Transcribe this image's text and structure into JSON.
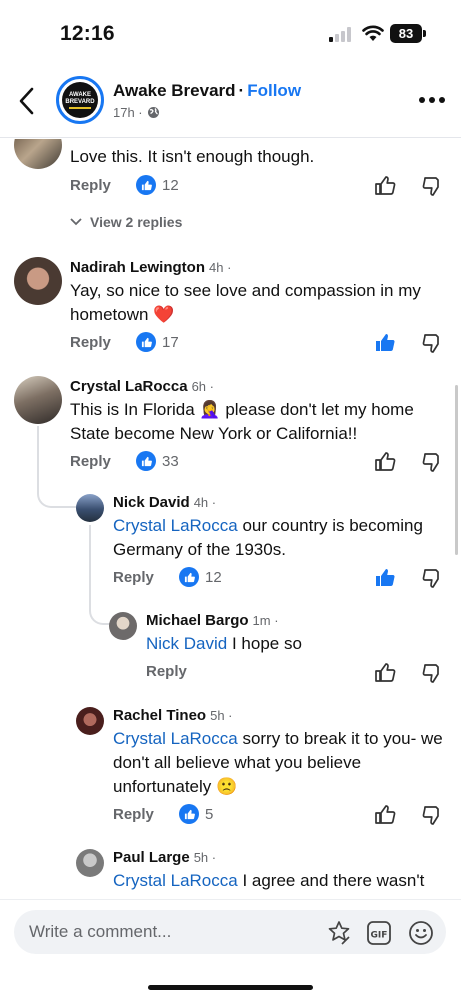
{
  "status_bar": {
    "time": "12:16",
    "battery": "83"
  },
  "header": {
    "page_name": "Awake Brevard",
    "separator": "·",
    "follow_label": "Follow",
    "time_ago": "17h ·",
    "avatar_text_line1": "AWAKE",
    "avatar_text_line2": "BREVARD"
  },
  "comments": [
    {
      "text": "Love this. It isn't enough though.",
      "reply_label": "Reply",
      "like_count": "12",
      "view_replies": "View 2 replies"
    },
    {
      "author": "Nadirah Lewington",
      "time": "4h ·",
      "text": "Yay, so nice to see love and compassion in my hometown ❤️",
      "reply_label": "Reply",
      "like_count": "17"
    },
    {
      "author": "Crystal LaRocca",
      "time": "6h ·",
      "text": "This is In Florida 🤦‍♀️ please don't let my home State become New York or California!!",
      "reply_label": "Reply",
      "like_count": "33"
    },
    {
      "author": "Nick David",
      "time": "4h ·",
      "mention": "Crystal LaRocca",
      "text": " our country is becoming Germany of the 1930s.",
      "reply_label": "Reply",
      "like_count": "12"
    },
    {
      "author": "Michael Bargo",
      "time": "1m ·",
      "mention": "Nick David",
      "text": " I hope so",
      "reply_label": "Reply"
    },
    {
      "author": "Rachel Tineo",
      "time": "5h ·",
      "mention": "Crystal LaRocca",
      "text": " sorry to break it to you- we don't all believe what you believe unfortunately 🙁",
      "reply_label": "Reply",
      "like_count": "5"
    },
    {
      "author": "Paul Large",
      "time": "5h ·",
      "mention": "Crystal LaRocca",
      "text": " I agree and there wasn't"
    }
  ],
  "composer": {
    "placeholder": "Write a comment..."
  },
  "colors": {
    "accent": "#1877f2",
    "mention": "#1564c0",
    "muted": "#65676b"
  }
}
